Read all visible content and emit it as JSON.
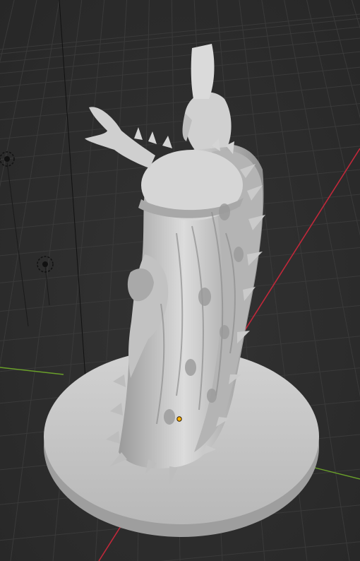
{
  "viewport": {
    "name": "3D Viewport",
    "background_color": "#2c2c2c",
    "grid_color": "#3a3a3a",
    "x_axis_color": "#c0283a",
    "y_axis_color": "#6aa02a",
    "model_color": "#c8c8c8",
    "base_color": "#c4c4c4",
    "origin_color": "#ffb000"
  },
  "scene_objects": [
    {
      "name": "statue-model",
      "type": "sculpted mesh"
    },
    {
      "name": "round-base",
      "type": "cylinder"
    },
    {
      "name": "light-1",
      "type": "light"
    },
    {
      "name": "light-2",
      "type": "light"
    },
    {
      "name": "camera-line",
      "type": "object-relation"
    }
  ]
}
